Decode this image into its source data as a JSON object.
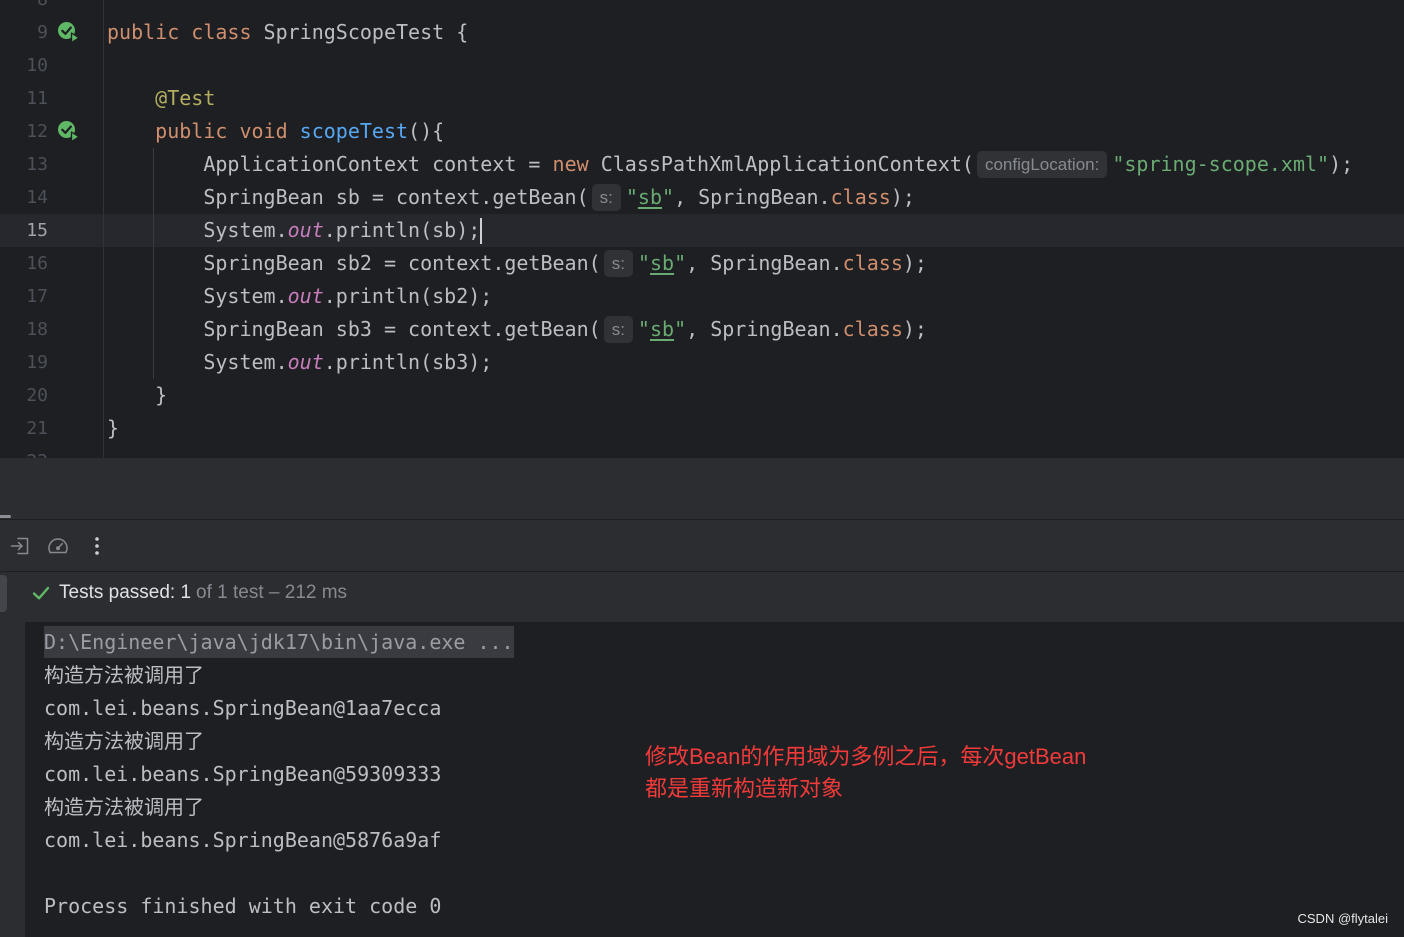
{
  "theme": {
    "editor_bg": "#1e1f22",
    "panel_bg": "#2b2d30",
    "text": "#bcbec4",
    "keyword": "#cf8e6d",
    "string": "#6aab73",
    "method": "#56a8f5",
    "annotation": "#b3ae60",
    "static_field": "#c77dbb",
    "line_number": "#4b5059",
    "current_line_number": "#a1a3ab",
    "current_line_bg": "#26282e",
    "hint_bg": "#303236",
    "hint_text": "#868a91",
    "success": "#5fb865",
    "muted": "#868a91",
    "note_red": "#f23a3a"
  },
  "editor": {
    "lines": [
      {
        "num": "8",
        "tokens": []
      },
      {
        "num": "9",
        "run_icon": "run-test-icon",
        "tokens": [
          {
            "t": "public class",
            "k": "kw"
          },
          {
            "t": " SpringScopeTest {",
            "k": "plain"
          }
        ]
      },
      {
        "num": "10",
        "tokens": []
      },
      {
        "num": "11",
        "tokens": [
          {
            "t": "    @Test",
            "k": "ann"
          }
        ]
      },
      {
        "num": "12",
        "run_icon": "run-test-icon",
        "tokens": [
          {
            "t": "    public void",
            "k": "kw"
          },
          {
            "t": " scopeTest",
            "k": "fn"
          },
          {
            "t": "(){",
            "k": "plain"
          }
        ]
      },
      {
        "num": "13",
        "tokens": [
          {
            "t": "        ApplicationContext context = ",
            "k": "plain"
          },
          {
            "t": "new",
            "k": "kw"
          },
          {
            "t": " ClassPathXmlApplicationContext(",
            "k": "plain"
          },
          {
            "t": "configLocation:",
            "k": "hint"
          },
          {
            "t": "\"spring-scope.xml\"",
            "k": "str"
          },
          {
            "t": ");",
            "k": "plain"
          }
        ]
      },
      {
        "num": "14",
        "tokens": [
          {
            "t": "        SpringBean sb = context.getBean(",
            "k": "plain"
          },
          {
            "t": "s:",
            "k": "hint"
          },
          {
            "t": "\"",
            "k": "str"
          },
          {
            "t": "sb",
            "k": "ref"
          },
          {
            "t": "\"",
            "k": "str"
          },
          {
            "t": ", SpringBean.",
            "k": "plain"
          },
          {
            "t": "class",
            "k": "kw"
          },
          {
            "t": ");",
            "k": "plain"
          }
        ]
      },
      {
        "num": "15",
        "current": true,
        "cursor": true,
        "tokens": [
          {
            "t": "        System.",
            "k": "plain"
          },
          {
            "t": "out",
            "k": "static"
          },
          {
            "t": ".println(sb);",
            "k": "plain"
          }
        ]
      },
      {
        "num": "16",
        "tokens": [
          {
            "t": "        SpringBean sb2 = context.getBean(",
            "k": "plain"
          },
          {
            "t": "s:",
            "k": "hint"
          },
          {
            "t": "\"",
            "k": "str"
          },
          {
            "t": "sb",
            "k": "ref"
          },
          {
            "t": "\"",
            "k": "str"
          },
          {
            "t": ", SpringBean.",
            "k": "plain"
          },
          {
            "t": "class",
            "k": "kw"
          },
          {
            "t": ");",
            "k": "plain"
          }
        ]
      },
      {
        "num": "17",
        "tokens": [
          {
            "t": "        System.",
            "k": "plain"
          },
          {
            "t": "out",
            "k": "static"
          },
          {
            "t": ".println(sb2);",
            "k": "plain"
          }
        ]
      },
      {
        "num": "18",
        "tokens": [
          {
            "t": "        SpringBean sb3 = context.getBean(",
            "k": "plain"
          },
          {
            "t": "s:",
            "k": "hint"
          },
          {
            "t": "\"",
            "k": "str"
          },
          {
            "t": "sb",
            "k": "ref"
          },
          {
            "t": "\"",
            "k": "str"
          },
          {
            "t": ", SpringBean.",
            "k": "plain"
          },
          {
            "t": "class",
            "k": "kw"
          },
          {
            "t": ");",
            "k": "plain"
          }
        ]
      },
      {
        "num": "19",
        "tokens": [
          {
            "t": "        System.",
            "k": "plain"
          },
          {
            "t": "out",
            "k": "static"
          },
          {
            "t": ".println(sb3);",
            "k": "plain"
          }
        ]
      },
      {
        "num": "20",
        "tokens": [
          {
            "t": "    }",
            "k": "plain"
          }
        ]
      },
      {
        "num": "21",
        "tokens": [
          {
            "t": "}",
            "k": "plain"
          }
        ]
      },
      {
        "num": "22",
        "tokens": []
      }
    ]
  },
  "run_panel": {
    "toolbar_icons": [
      "import-tests-icon",
      "gauge-icon",
      "more-options-icon"
    ],
    "status": {
      "icon": "check-icon",
      "passed_label": "Tests passed: 1",
      "detail": "of 1 test – 212 ms"
    },
    "console": {
      "command": "D:\\Engineer\\java\\jdk17\\bin\\java.exe ...",
      "output": [
        "构造方法被调用了",
        "com.lei.beans.SpringBean@1aa7ecca",
        "构造方法被调用了",
        "com.lei.beans.SpringBean@59309333",
        "构造方法被调用了",
        "com.lei.beans.SpringBean@5876a9af"
      ],
      "exit_message": "Process finished with exit code 0"
    }
  },
  "note": {
    "lines": [
      "修改Bean的作用域为多例之后，每次getBean",
      "都是重新构造新对象"
    ]
  },
  "watermark": "CSDN @flytalei"
}
